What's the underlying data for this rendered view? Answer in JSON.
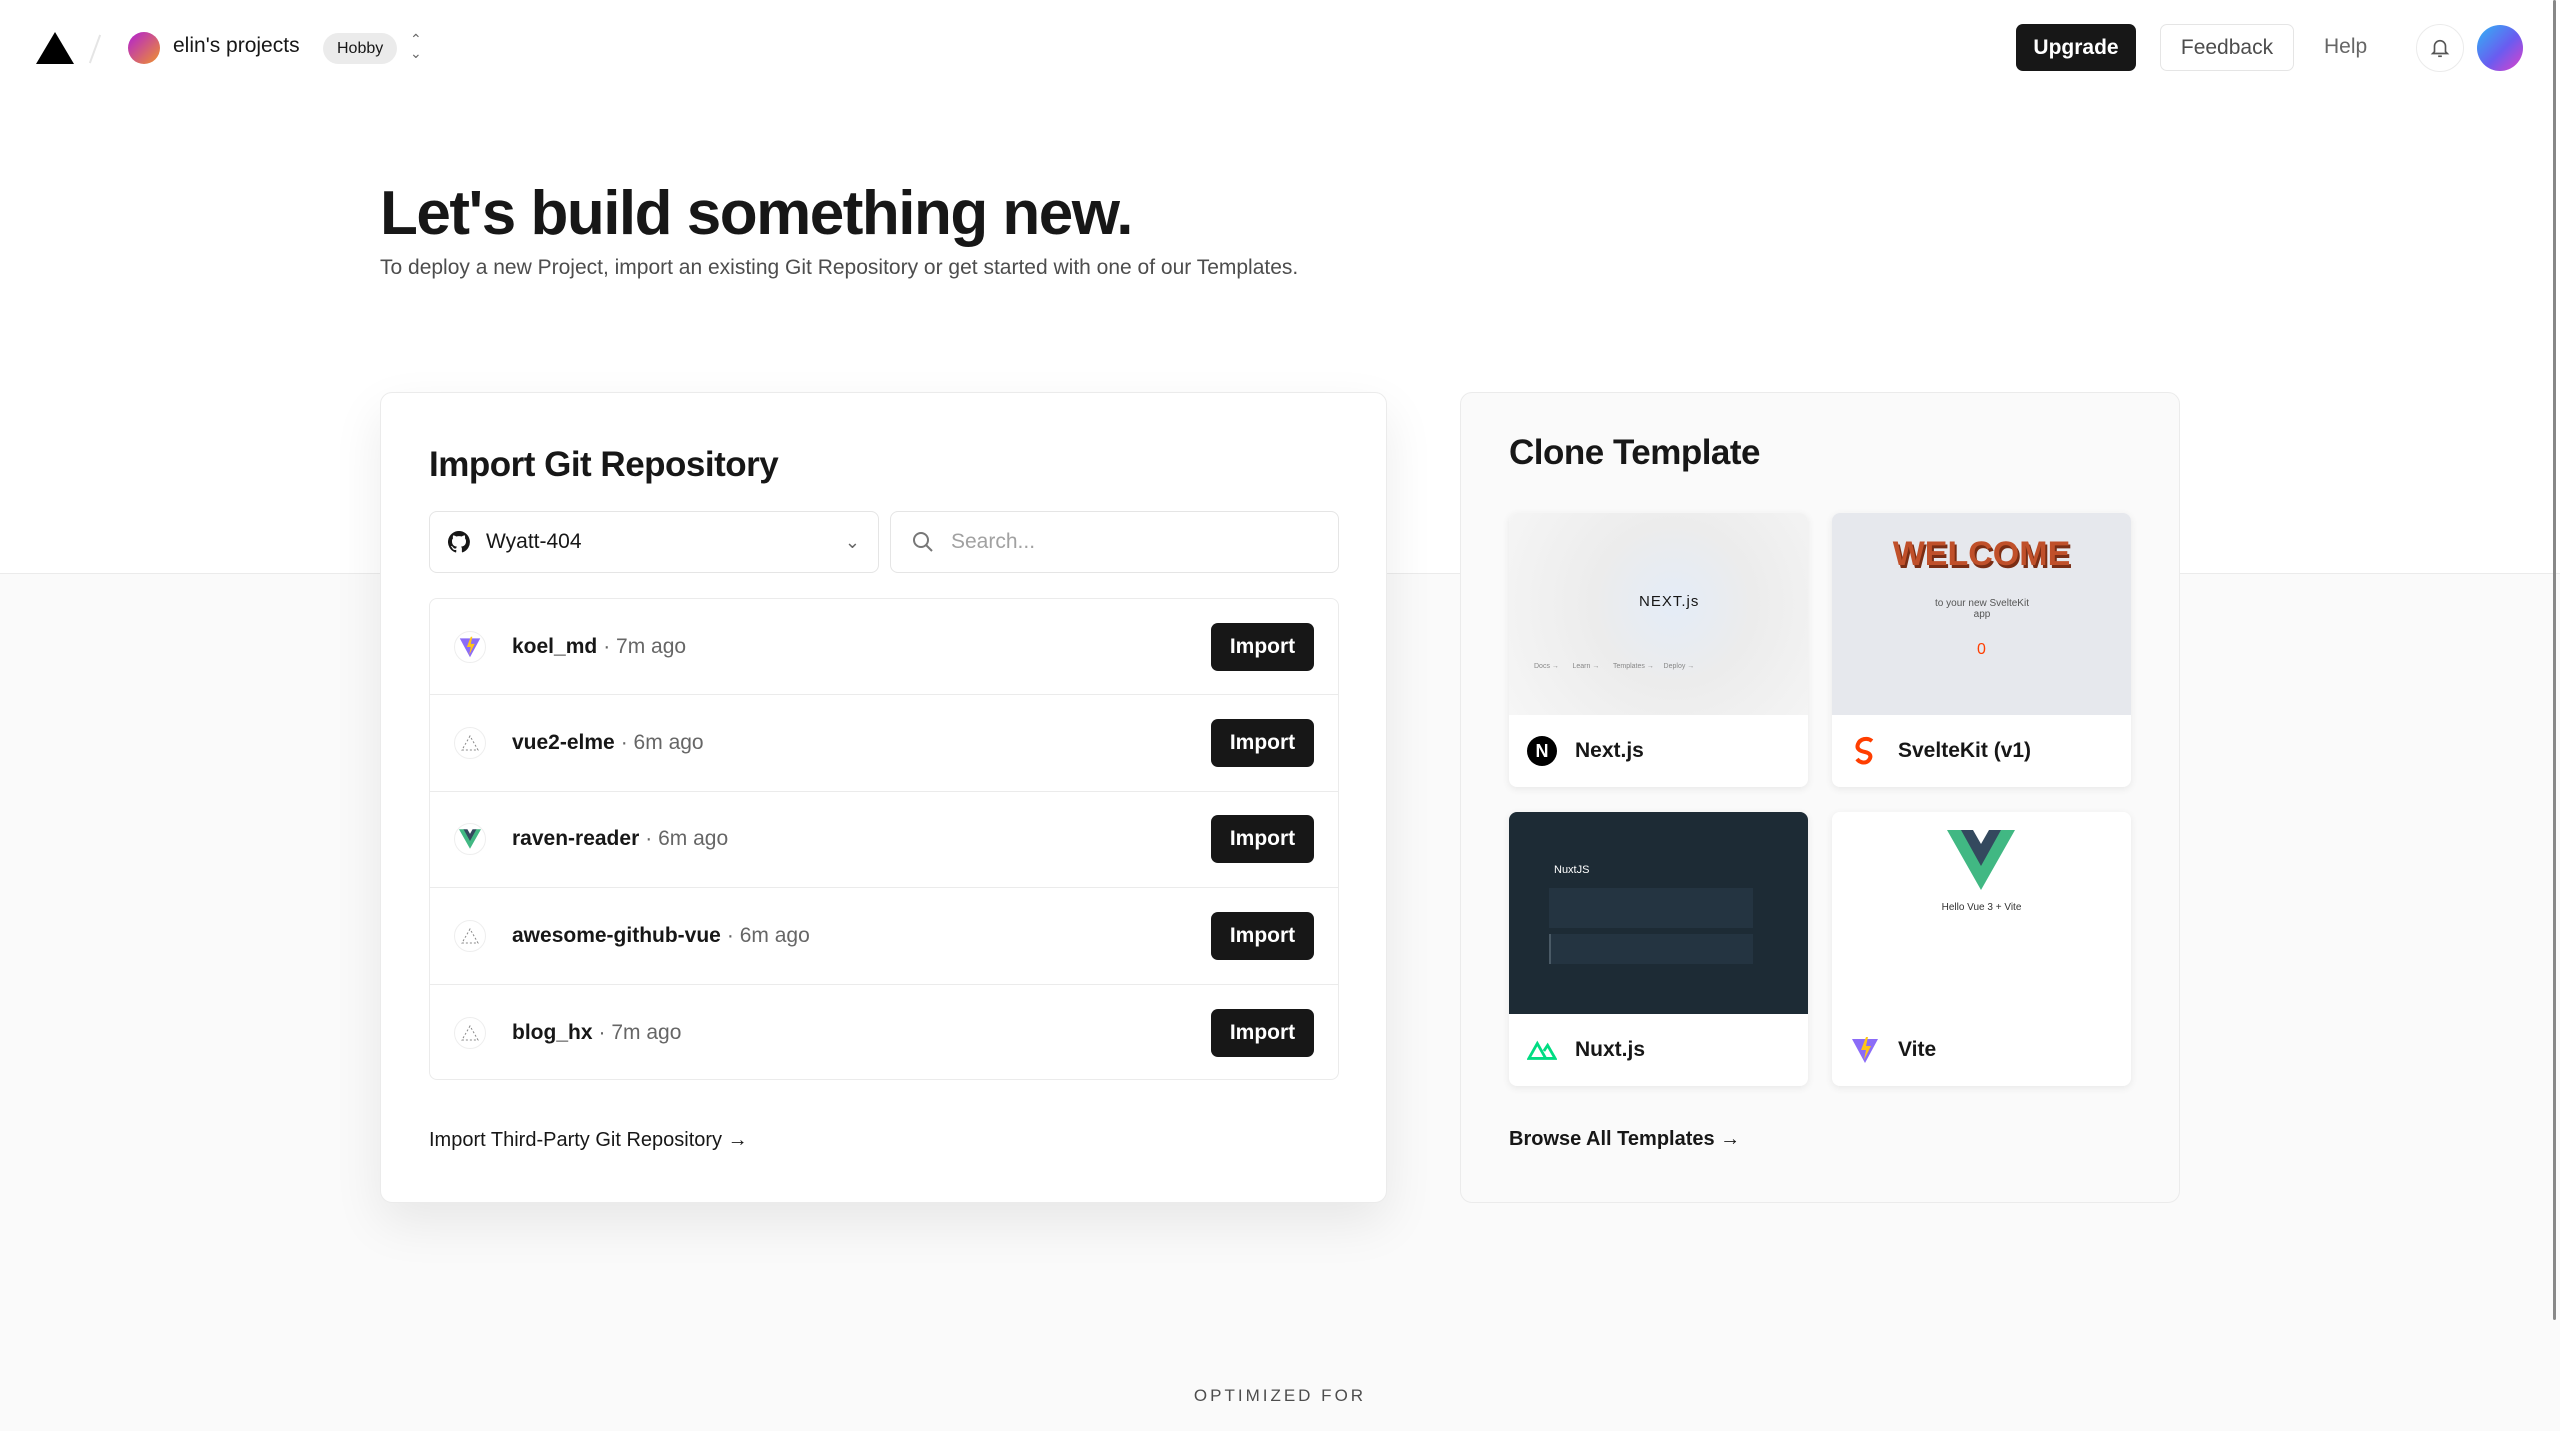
{
  "header": {
    "team_name": "elin's projects",
    "plan_badge": "Hobby",
    "upgrade": "Upgrade",
    "feedback": "Feedback",
    "help": "Help"
  },
  "hero": {
    "title": "Let's build something new.",
    "subtitle": "To deploy a new Project, import an existing Git Repository or get started with one of our Templates."
  },
  "import": {
    "title": "Import Git Repository",
    "account": "Wyatt-404",
    "search_placeholder": "Search...",
    "repos": [
      {
        "name": "koel_md",
        "time": "· 7m ago",
        "icon": "vite-icon"
      },
      {
        "name": "vue2-elme",
        "time": "· 6m ago",
        "icon": "vercel-placeholder-icon"
      },
      {
        "name": "raven-reader",
        "time": "· 6m ago",
        "icon": "vue-icon"
      },
      {
        "name": "awesome-github-vue",
        "time": "· 6m ago",
        "icon": "vercel-placeholder-icon"
      },
      {
        "name": "blog_hx",
        "time": "· 7m ago",
        "icon": "vercel-placeholder-icon"
      }
    ],
    "import_label": "Import",
    "third_party": "Import Third-Party Git Repository →"
  },
  "templates": {
    "title": "Clone Template",
    "items": [
      {
        "name": "Next.js",
        "preview_text": "NEXT.js"
      },
      {
        "name": "SvelteKit (v1)",
        "preview_text": "WELCOME",
        "preview_sub": "to your new SvelteKit app",
        "preview_count": "0"
      },
      {
        "name": "Nuxt.js",
        "preview_text": "NuxtJS"
      },
      {
        "name": "Vite",
        "preview_text": "Hello Vue 3 + Vite"
      }
    ],
    "browse": "Browse All Templates →"
  },
  "footer": {
    "optimized": "OPTIMIZED FOR"
  },
  "colors": {
    "accent": "#171717",
    "background_band": "#fafafa"
  }
}
